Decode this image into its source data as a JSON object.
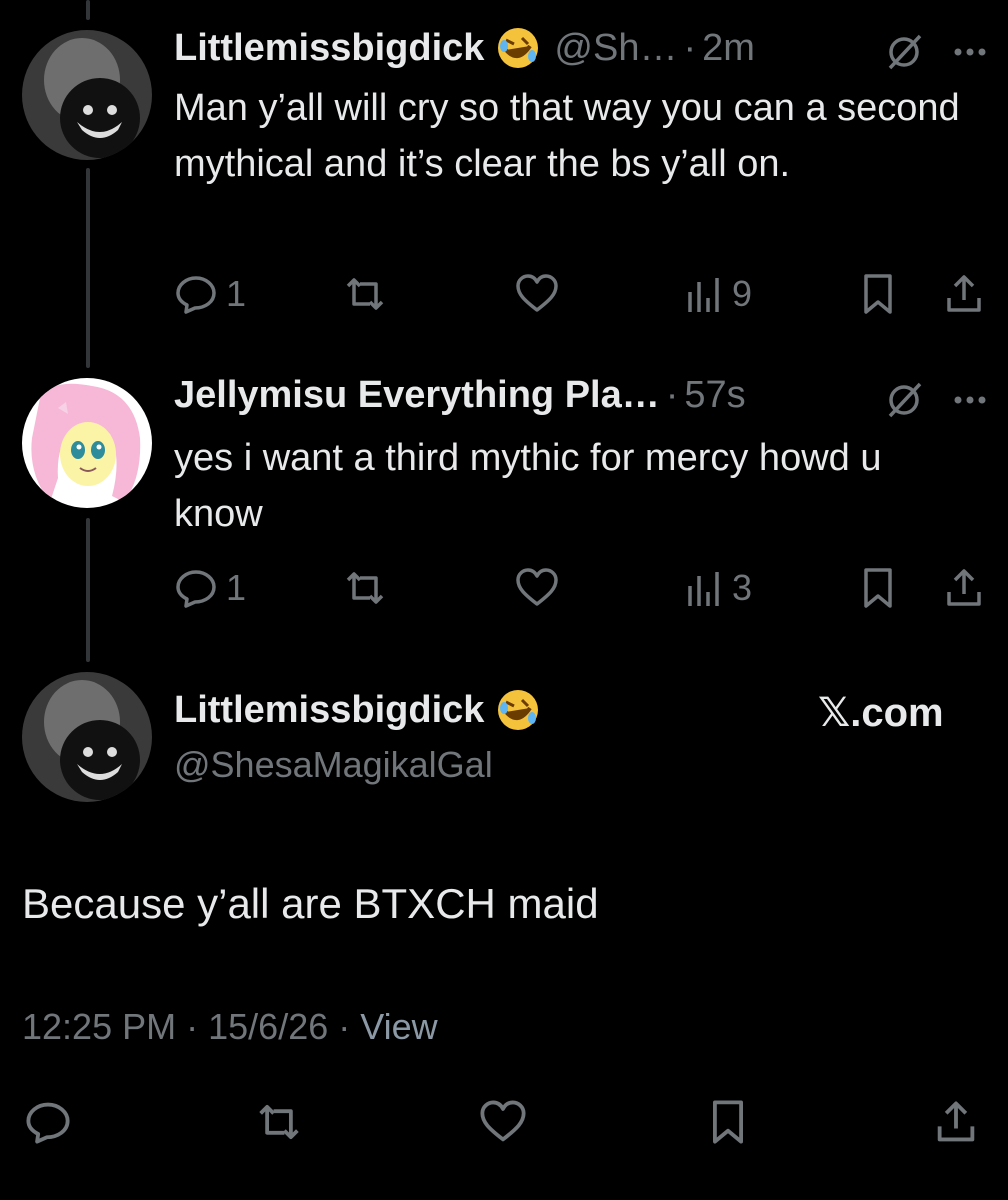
{
  "tweets": [
    {
      "name": "Littlemissbigdick",
      "emoji": "rofl-emoji",
      "handle": "@Sh…",
      "time": "2m",
      "text": "Man y’all will cry so that way you can a second mythical and it’s clear the bs y’all on.",
      "replies": "1",
      "views": "9"
    },
    {
      "name": "Jellymisu Everything Pla…",
      "time": "57s",
      "text": "yes i want a third mythic for mercy howd u know",
      "replies": "1",
      "views": "3"
    }
  ],
  "main": {
    "name": "Littlemissbigdick",
    "handle": "@ShesaMagikalGal",
    "source": "𝕏.com",
    "text": "Because y’all are BTXCH maid",
    "time": "12:25 PM",
    "date": "15/6/26",
    "view_label": "View"
  },
  "separator": "·",
  "colors": {
    "background": "#000000",
    "text": "#e7e9ea",
    "muted": "#71767b"
  }
}
